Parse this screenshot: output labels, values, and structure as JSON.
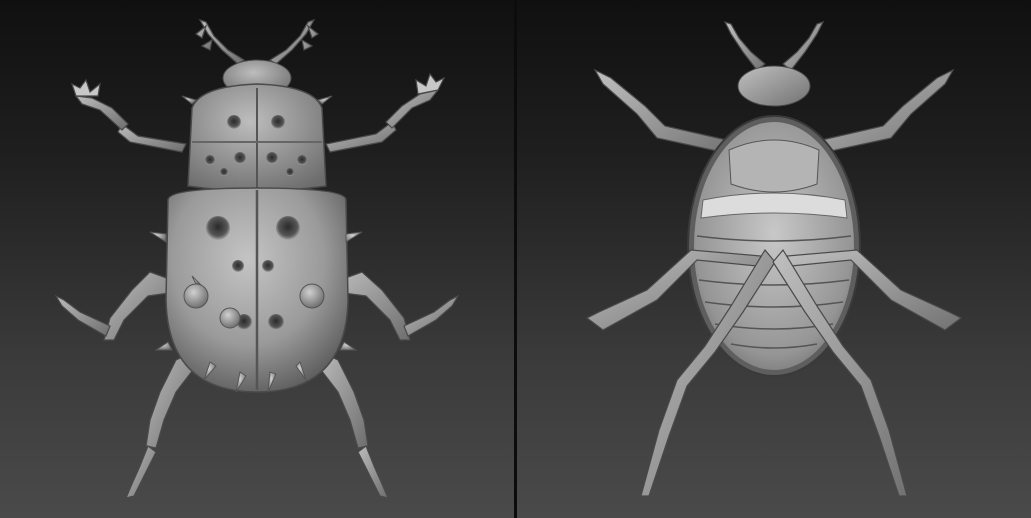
{
  "views": [
    {
      "id": "dorsal",
      "label": ""
    },
    {
      "id": "ventral",
      "label": ""
    }
  ],
  "colors": {
    "background_top": "#101010",
    "background_bottom": "#4a4a4a",
    "divider": "#0c0c0c",
    "body_light": "#b8b8b8",
    "body_mid": "#8e8e8e",
    "body_dark": "#4e4e4e"
  }
}
